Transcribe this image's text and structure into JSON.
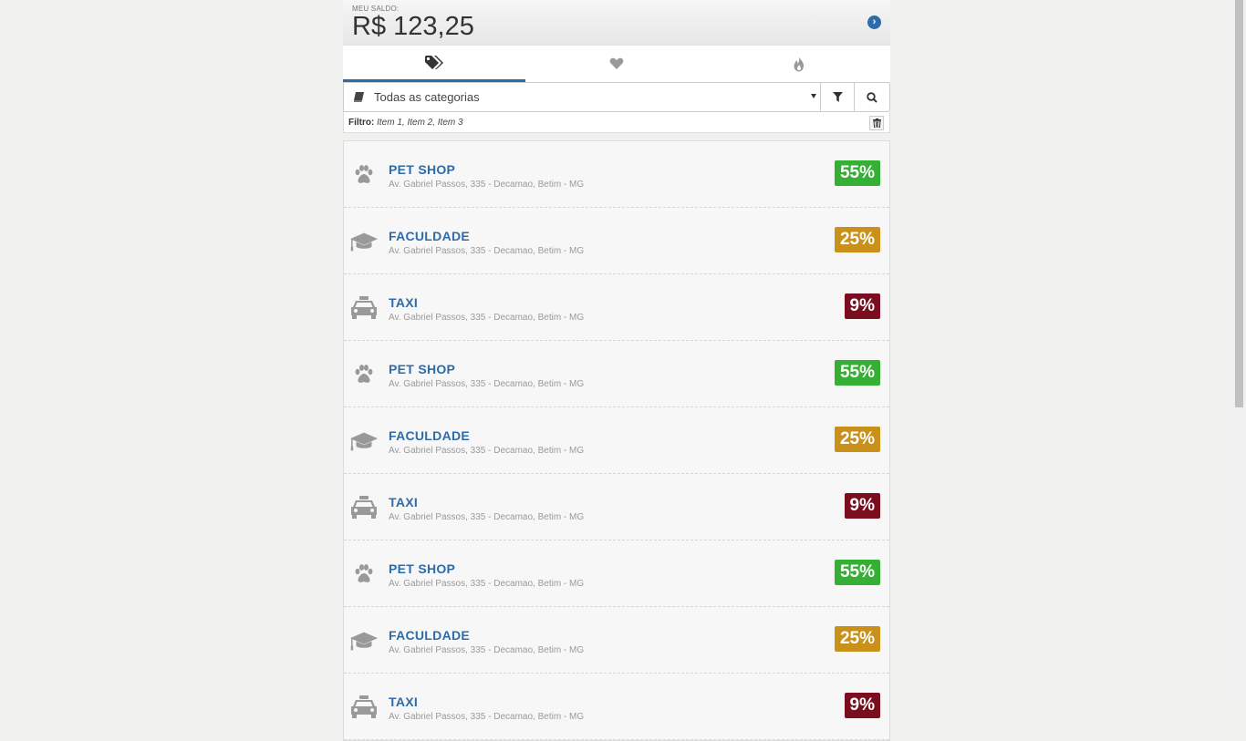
{
  "balance": {
    "label": "MEU SALDO:",
    "amount": "R$ 123,25"
  },
  "tabs": [
    {
      "icon": "tags-icon",
      "active": true
    },
    {
      "icon": "heart-icon",
      "active": false
    },
    {
      "icon": "fire-icon",
      "active": false
    }
  ],
  "filter": {
    "category_value": "Todas as categorias",
    "chips_label": "Filtro:",
    "chips_value": "Item 1, Item 2, Item 3"
  },
  "colors": {
    "accent": "#2d6ca8",
    "green": "#35b034",
    "gold": "#c9911a",
    "red": "#7a0e1f"
  },
  "offers": [
    {
      "name": "PET SHOP",
      "address": "Av. Gabriel Passos, 335 - Decamao, Betim - MG",
      "discount": "55%",
      "icon": "paw-icon",
      "color": "#35b034"
    },
    {
      "name": "FACULDADE",
      "address": "Av. Gabriel Passos, 335 - Decamao, Betim - MG",
      "discount": "25%",
      "icon": "graduation-cap-icon",
      "color": "#c9911a"
    },
    {
      "name": "TAXI",
      "address": "Av. Gabriel Passos, 335 - Decamao, Betim - MG",
      "discount": "9%",
      "icon": "taxi-icon",
      "color": "#7a0e1f"
    },
    {
      "name": "PET SHOP",
      "address": "Av. Gabriel Passos, 335 - Decamao, Betim - MG",
      "discount": "55%",
      "icon": "paw-icon",
      "color": "#35b034"
    },
    {
      "name": "FACULDADE",
      "address": "Av. Gabriel Passos, 335 - Decamao, Betim - MG",
      "discount": "25%",
      "icon": "graduation-cap-icon",
      "color": "#c9911a"
    },
    {
      "name": "TAXI",
      "address": "Av. Gabriel Passos, 335 - Decamao, Betim - MG",
      "discount": "9%",
      "icon": "taxi-icon",
      "color": "#7a0e1f"
    },
    {
      "name": "PET SHOP",
      "address": "Av. Gabriel Passos, 335 - Decamao, Betim - MG",
      "discount": "55%",
      "icon": "paw-icon",
      "color": "#35b034"
    },
    {
      "name": "FACULDADE",
      "address": "Av. Gabriel Passos, 335 - Decamao, Betim - MG",
      "discount": "25%",
      "icon": "graduation-cap-icon",
      "color": "#c9911a"
    },
    {
      "name": "TAXI",
      "address": "Av. Gabriel Passos, 335 - Decamao, Betim - MG",
      "discount": "9%",
      "icon": "taxi-icon",
      "color": "#7a0e1f"
    }
  ]
}
